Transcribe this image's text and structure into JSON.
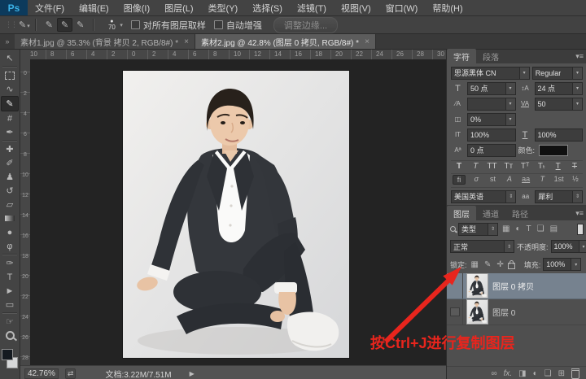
{
  "colors": {
    "annotation_red": "#e8251d",
    "selected_layer_bg": "#76828f",
    "ps_logo_blue": "#3ab2e8"
  },
  "menubar": {
    "logo": "Ps",
    "items": [
      "文件(F)",
      "编辑(E)",
      "图像(I)",
      "图层(L)",
      "类型(Y)",
      "选择(S)",
      "滤镜(T)",
      "视图(V)",
      "窗口(W)",
      "帮助(H)"
    ]
  },
  "optionsbar": {
    "brush_size": "70",
    "sample_all_layers": "对所有图层取样",
    "auto_enhance": "自动增强",
    "refine_edge": "调整边缘..."
  },
  "tabbar": {
    "tab1": "素材1.jpg @ 35.3% (背景 拷贝 2, RGB/8#) *",
    "tab2": "素材2.jpg @ 42.8% (图层 0 拷贝, RGB/8#) *"
  },
  "toolbar": {
    "glyphs": [
      "↖",
      "",
      "∿",
      "✎",
      "#",
      "✒",
      "✚",
      "✐",
      "♟",
      "↺",
      "▱",
      "",
      "●",
      "φ",
      "✑",
      "T",
      "►",
      "▭",
      "☞",
      ""
    ]
  },
  "rulers": {
    "h": [
      "10",
      "8",
      "6",
      "4",
      "2",
      "0",
      "2",
      "4",
      "6",
      "8",
      "10",
      "12",
      "14",
      "16",
      "18",
      "20",
      "22",
      "24",
      "26",
      "28",
      "30"
    ],
    "v": [
      "0",
      "2",
      "4",
      "6",
      "8",
      "10",
      "12",
      "14",
      "16",
      "18",
      "20",
      "22",
      "24",
      "26",
      "28"
    ]
  },
  "character_panel": {
    "tab_character": "字符",
    "tab_paragraph": "段落",
    "font_family": "思源黑体 CN",
    "font_style": "Regular",
    "font_size": "50 点",
    "leading": "24 点",
    "kerning": "",
    "tracking": "50",
    "proportional_spacing": "0%",
    "vertical_scale": "100%",
    "horizontal_scale": "100%",
    "baseline_shift": "0 点",
    "color_label": "颜色:",
    "style_buttons": [
      "T",
      "T",
      "TT",
      "Tᴛ",
      "Tᵀ",
      "Tₜ",
      "T",
      "T"
    ],
    "opentype_buttons": [
      "fi",
      "σ",
      "st",
      "A",
      "aa",
      "T",
      "1st",
      "½"
    ],
    "language": "美国英语",
    "antialias": "犀利"
  },
  "layers_panel": {
    "tab_layers": "图层",
    "tab_channels": "通道",
    "tab_paths": "路径",
    "filter_label": "类型",
    "blend_mode": "正常",
    "opacity_label": "不透明度:",
    "opacity_value": "100%",
    "lock_label": "锁定:",
    "fill_label": "填充:",
    "fill_value": "100%",
    "layers": [
      {
        "name": "图层 0 拷贝"
      },
      {
        "name": "图层 0"
      }
    ]
  },
  "statusbar": {
    "zoom": "42.76%",
    "doc_info": "文档:3.22M/7.51M"
  },
  "annotation": {
    "text": "按Ctrl+J进行复制图层"
  },
  "icons": {
    "grip": "⋮⋮",
    "tool_preset": "✎",
    "dropdown": "▾",
    "combo": "⇕",
    "qs_new": "✎",
    "qs_add": "✎",
    "qs_sub": "✎",
    "brush_dot": "●",
    "tab_overflow": "»",
    "close": "×",
    "panel_menu": "▾≡",
    "font_size": "T",
    "leading": "↕A",
    "kerning": "⁄A",
    "tracking": "VA",
    "prop_spacing": "◫",
    "vscale": "IT",
    "hscale": "T",
    "baseline": "Aª",
    "language_aa": "aa",
    "filter_image": "▦",
    "filter_adjust": "◐",
    "filter_type": "T",
    "filter_shape": "❏",
    "filter_smart": "▤",
    "lock_transparent": "▦",
    "lock_paint": "✎",
    "lock_move": "✛",
    "link": "∞",
    "fx": "fx.",
    "mask": "◨",
    "adjustment": "◐",
    "group": "❏",
    "new_layer": "⊞",
    "scrubby": "⇄",
    "status_arrow": "▶"
  }
}
